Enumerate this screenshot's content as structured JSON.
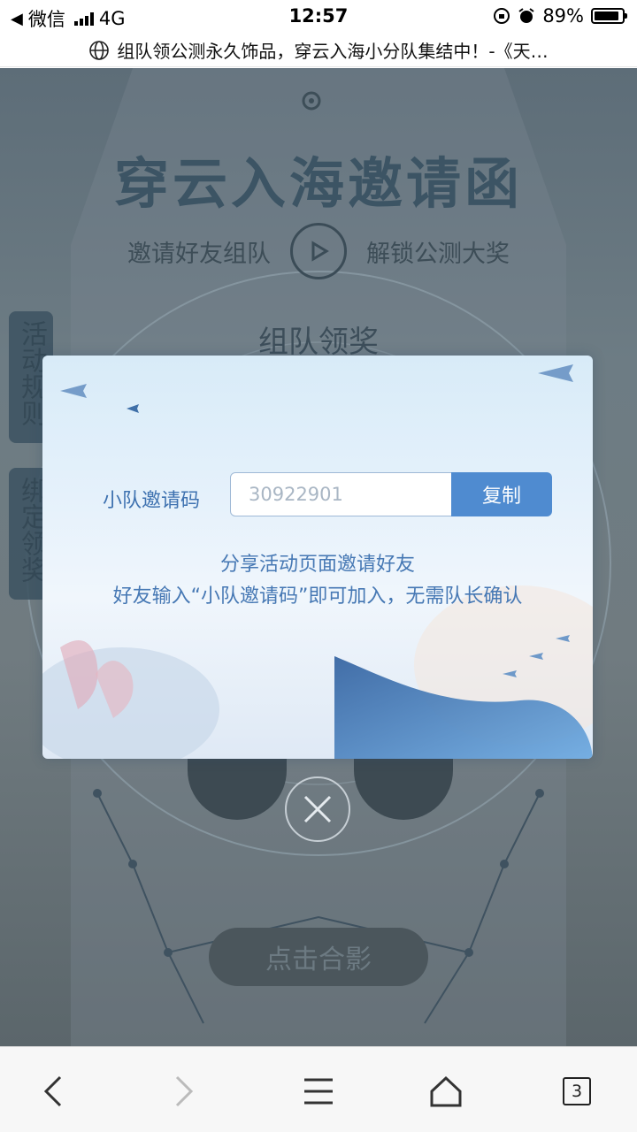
{
  "status_bar": {
    "carrier": "微信",
    "network": "4G",
    "time": "12:57",
    "battery": "89%",
    "battery_level": 0.89
  },
  "title_bar": {
    "title": "组队领公测永久饰品，穿云入海小分队集结中！-《天…"
  },
  "page": {
    "hero_title": "穿云入海邀请函",
    "hero_sub_left": "邀请好友组队",
    "hero_sub_right": "解锁公测大奖",
    "team_title": "组队领奖",
    "side_tab_rules": "活动规则",
    "side_tab_bind": "绑定领奖",
    "photo_button": "点击合影"
  },
  "modal": {
    "code_label": "小队邀请码",
    "code_value": "30922901",
    "copy_button": "复制",
    "hint_line1": "分享活动页面邀请好友",
    "hint_line2": "好友输入“小队邀请码”即可加入，无需队长确认"
  },
  "bottom_bar": {
    "tab_count": "3"
  },
  "colors": {
    "accent": "#4f8bd0",
    "modal_text": "#4678b4"
  }
}
